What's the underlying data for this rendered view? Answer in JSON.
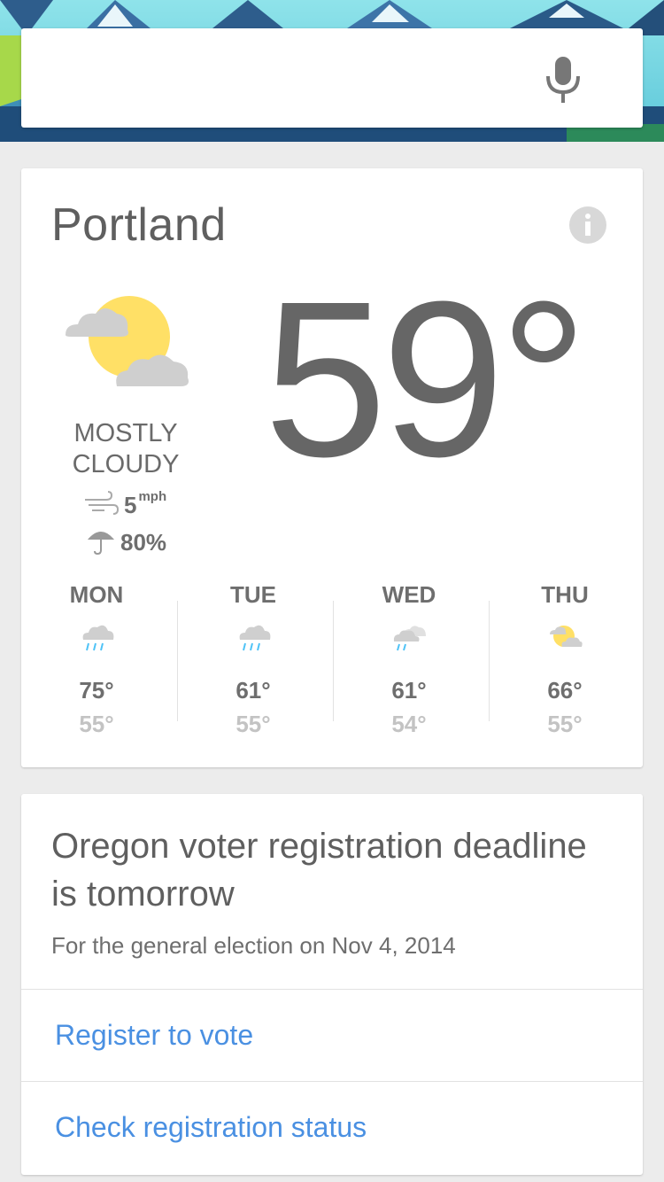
{
  "search": {
    "placeholder": "",
    "mic_icon": "microphone-icon"
  },
  "weather": {
    "city": "Portland",
    "info_icon": "info-icon",
    "current": {
      "temperature": "59°",
      "condition_line1": "MOSTLY",
      "condition_line2": "CLOUDY",
      "icon": "mostly-cloudy-icon",
      "wind_value": "5",
      "wind_unit": "mph",
      "wind_icon": "wind-icon",
      "precip_value": "80%",
      "precip_icon": "umbrella-icon"
    },
    "forecast": [
      {
        "day": "MON",
        "hi": "75°",
        "lo": "55°",
        "icon": "rain-icon"
      },
      {
        "day": "TUE",
        "hi": "61°",
        "lo": "55°",
        "icon": "rain-icon"
      },
      {
        "day": "WED",
        "hi": "61°",
        "lo": "54°",
        "icon": "light-rain-icon"
      },
      {
        "day": "THU",
        "hi": "66°",
        "lo": "55°",
        "icon": "partly-cloudy-icon"
      }
    ]
  },
  "voter": {
    "title": "Oregon voter registration deadline is tomorrow",
    "subtitle": "For the general election on Nov 4, 2014",
    "link1": "Register to vote",
    "link2": "Check registration status"
  },
  "colors": {
    "link": "#4a90e2",
    "sun": "#ffe066",
    "cloud": "#cfcfcf",
    "rain": "#4fc3f7"
  }
}
